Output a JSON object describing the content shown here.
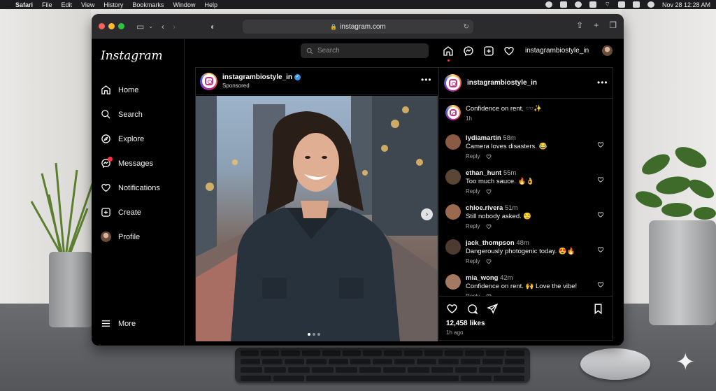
{
  "menubar": {
    "app": "Safari",
    "items": [
      "File",
      "Edit",
      "View",
      "History",
      "Bookmarks",
      "Window",
      "Help"
    ],
    "datetime": "Nov 28  12:28 AM"
  },
  "browser": {
    "url": "instagram.com"
  },
  "instagram": {
    "logo": "Instagram",
    "nav": [
      {
        "label": "Home",
        "icon": "home-icon"
      },
      {
        "label": "Search",
        "icon": "search-icon"
      },
      {
        "label": "Explore",
        "icon": "compass-icon"
      },
      {
        "label": "Messages",
        "icon": "messenger-icon"
      },
      {
        "label": "Notifications",
        "icon": "heart-icon"
      },
      {
        "label": "Create",
        "icon": "plus-square-icon"
      },
      {
        "label": "Profile",
        "icon": "avatar"
      }
    ],
    "more_label": "More",
    "search_placeholder": "Search",
    "header_username": "instagrambiostyle_in"
  },
  "post": {
    "username": "instagrambiostyle_in",
    "subtitle": "Sponsored",
    "caption": "Confidence on rent. 🕶️✨",
    "caption_time": "1h",
    "likes": "12,458 likes",
    "time_ago": "1h ago",
    "reply_label": "Reply",
    "colors": {
      "verified": "#3897f0",
      "notification_dot": "#ff3040"
    },
    "comments": [
      {
        "user": "lydiamartin",
        "time": "58m",
        "text": "Camera loves disasters. 😂",
        "avatar_color": "#8a5a44"
      },
      {
        "user": "ethan_hunt",
        "time": "55m",
        "text": "Too much sauce. 🔥👌",
        "avatar_color": "#5b4636"
      },
      {
        "user": "chloe.rivera",
        "time": "51m",
        "text": "Still nobody asked. 😏",
        "avatar_color": "#9b6a4e"
      },
      {
        "user": "jack_thompson",
        "time": "48m",
        "text": "Dangerously photogenic today. 😍🔥",
        "avatar_color": "#4d3a30"
      },
      {
        "user": "mia_wong",
        "time": "42m",
        "text": "Confidence on rent. 🙌 Love the vibe!",
        "avatar_color": "#a27a62"
      }
    ]
  }
}
